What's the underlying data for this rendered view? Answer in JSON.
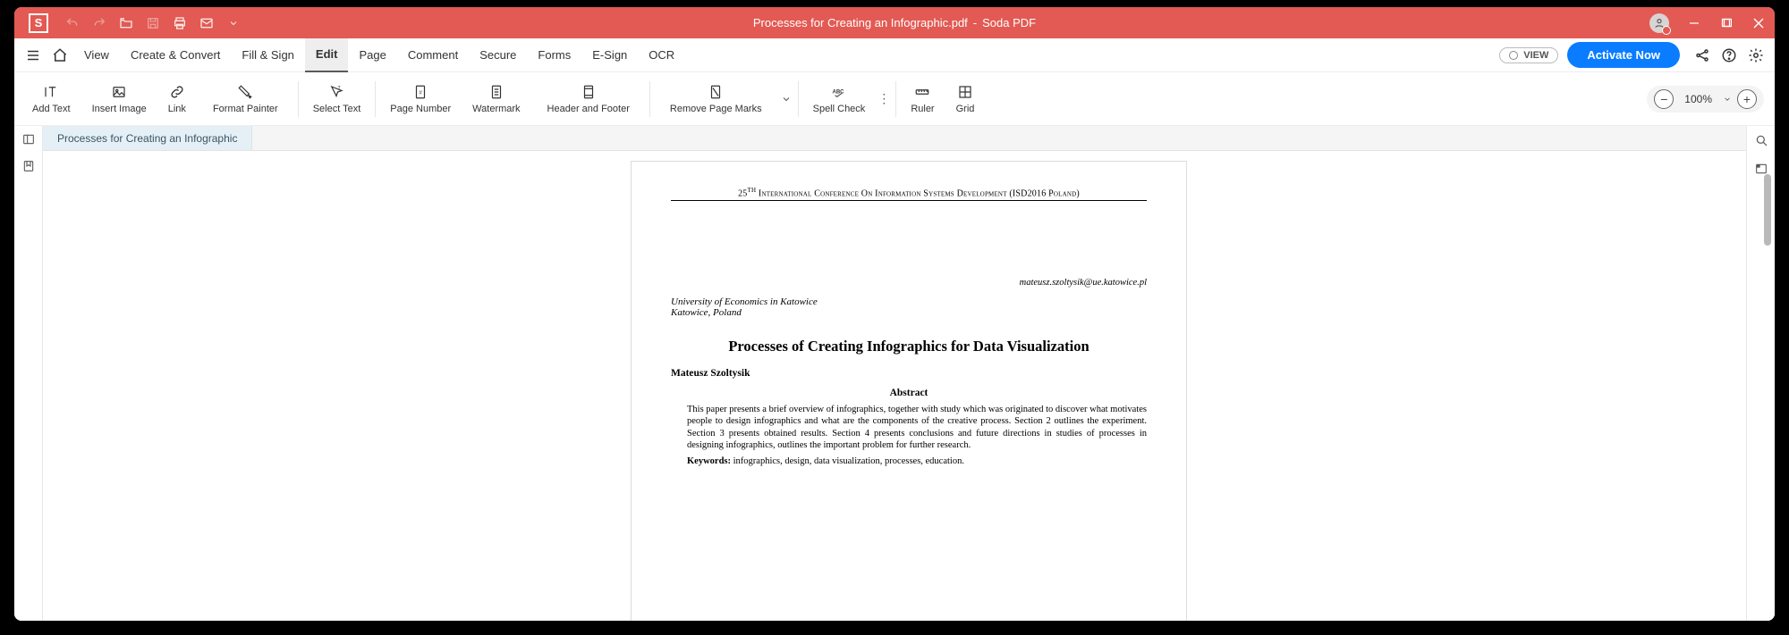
{
  "titlebar": {
    "file_name": "Processes for Creating an Infographic.pdf",
    "separator": "-",
    "app_name": "Soda PDF"
  },
  "menu": {
    "items": [
      "View",
      "Create & Convert",
      "Fill & Sign",
      "Edit",
      "Page",
      "Comment",
      "Secure",
      "Forms",
      "E-Sign",
      "OCR"
    ],
    "active_index": 3,
    "view_pill": "VIEW",
    "activate": "Activate Now"
  },
  "ribbon": {
    "add_text": "Add Text",
    "insert_image": "Insert Image",
    "link": "Link",
    "format_painter": "Format Painter",
    "select_text": "Select Text",
    "page_number": "Page Number",
    "watermark": "Watermark",
    "header_footer": "Header and Footer",
    "remove_marks": "Remove Page Marks",
    "spell_check": "Spell Check",
    "ruler": "Ruler",
    "grid": "Grid",
    "zoom": "100%"
  },
  "doc_tab": "Processes for Creating an Infographic",
  "paper": {
    "conference_prefix": "25",
    "conference_sup": "TH",
    "conference_rest": " International Conference On Information Systems Development (ISD2016 Poland)",
    "email": "mateusz.szoltysik@ue.katowice.pl",
    "affiliation1": "University of Economics in Katowice",
    "affiliation2": "Katowice, Poland",
    "title": "Processes of Creating Infographics for Data Visualization",
    "author": "Mateusz Szoltysik",
    "abstract_heading": "Abstract",
    "abstract": "This paper presents a brief overview of infographics, together with study which was originated to discover what motivates people to design infographics and what are the components of the creative process. Section 2 outlines the experiment. Section 3 presents obtained results. Section 4 presents conclusions and future directions in studies of processes in designing infographics, outlines the important problem for further research.",
    "keywords_label": "Keywords:",
    "keywords": " infographics, design, data visualization, processes, education."
  }
}
